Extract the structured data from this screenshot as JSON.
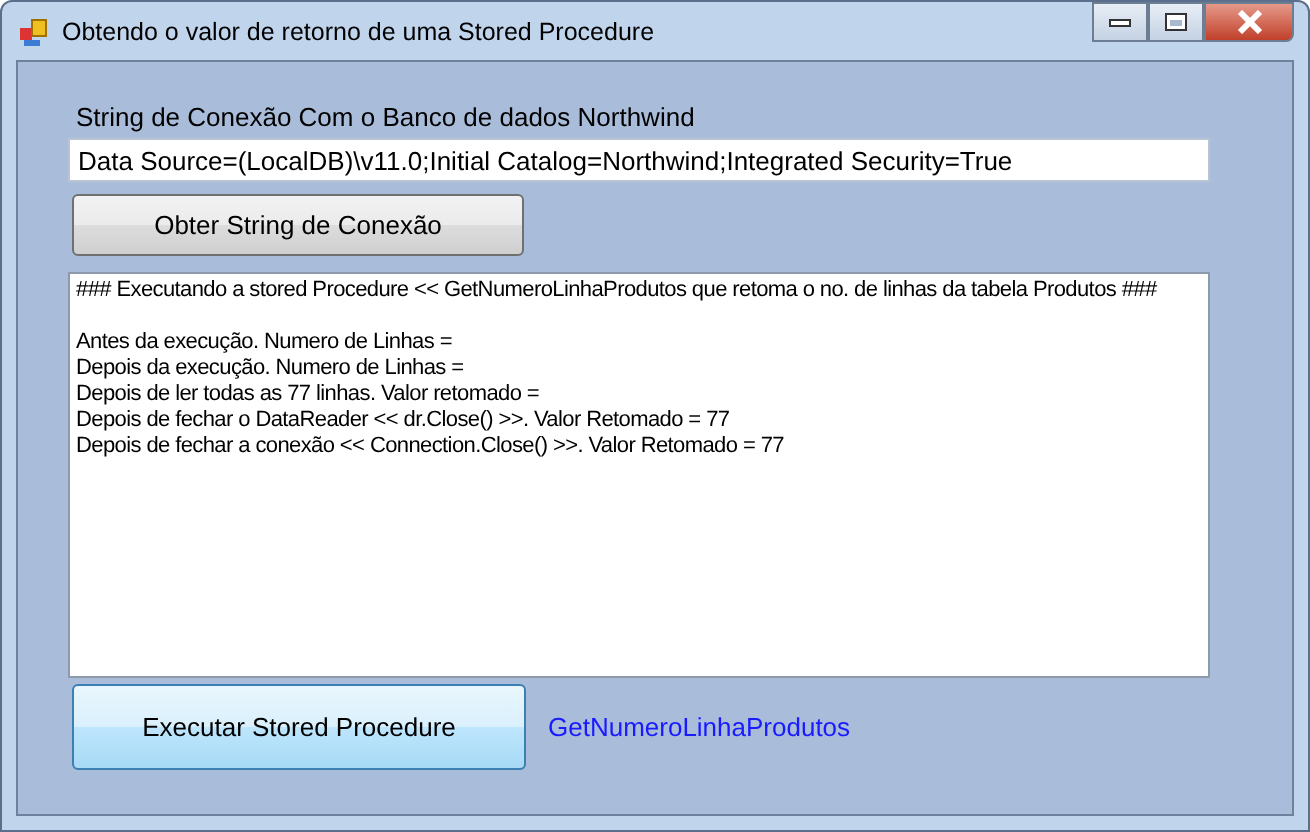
{
  "window": {
    "title": "Obtendo o valor de retorno de uma Stored Procedure"
  },
  "connection_label": "String de Conexão Com o Banco de dados Northwind",
  "connection_field": {
    "value": "Data Source=(LocalDB)\\v11.0;Initial Catalog=Northwind;Integrated Security=True"
  },
  "get_button": {
    "label": "Obter String de Conexão",
    "highlighted": false
  },
  "output_header": "### Executando a stored Procedure << GetNumeroLinhaProdutos que retoma o no. de linhas da tabela Produtos  ###",
  "output_lines": [
    "Antes da execução.  Numero de Linhas =",
    "Depois da execução. Numero de Linhas =",
    "Depois de ler todas as 77 linhas.  Valor retomado  =",
    "Depois de fechar o DataReader  << dr.Close() >>. Valor Retomado =  77",
    "Depois de fechar a conexão << Connection.Close() >>. Valor Retomado =  77"
  ],
  "run_button": {
    "label": "Executar Stored Procedure",
    "highlighted": true
  },
  "procedure_label": "GetNumeroLinhaProdutos"
}
